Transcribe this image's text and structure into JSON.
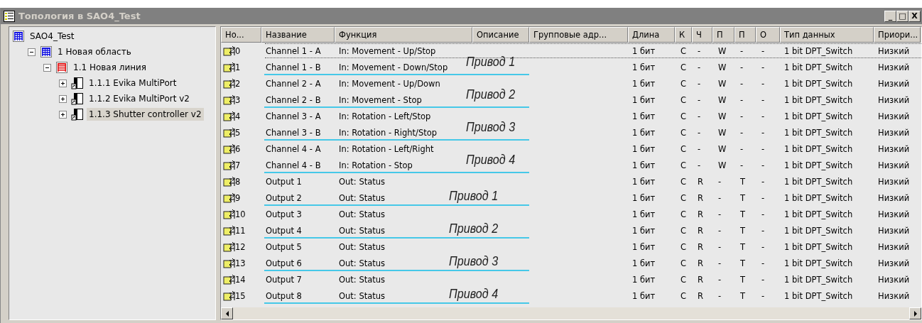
{
  "window": {
    "title": "Топология в SAO4_Test",
    "controls": [
      "_",
      "□",
      "X"
    ]
  },
  "tree": [
    {
      "label": "SAO4_Test",
      "kind": "project",
      "selected": false,
      "children": [
        {
          "label": "1 Новая область",
          "kind": "area",
          "expanded": true,
          "selected": false,
          "children": [
            {
              "label": "1.1 Новая линия",
              "kind": "line",
              "expanded": true,
              "selected": false,
              "children": [
                {
                  "label": "1.1.1 Evika MultiPort",
                  "kind": "device",
                  "expanded": false,
                  "selected": false
                },
                {
                  "label": "1.1.2 Evika MultiPort v2",
                  "kind": "device",
                  "expanded": false,
                  "selected": false
                },
                {
                  "label": "1.1.3 Shutter controller v2",
                  "kind": "device",
                  "expanded": false,
                  "selected": true
                }
              ]
            }
          ]
        }
      ]
    }
  ],
  "table": {
    "columns": [
      "Но...",
      "Название",
      "Функция",
      "Описание",
      "Групповые адр...",
      "Длина",
      "К",
      "Ч",
      "П",
      "П",
      "О",
      "Тип данных",
      "Приори..."
    ],
    "row_groups": [
      {
        "annotation": "Привод 1",
        "rows": [
          {
            "number": "0",
            "name": "Channel 1 - A",
            "function": "In: Movement - Up/Stop",
            "length": "1 бит",
            "flag_k": "C",
            "flag_ch": "-",
            "flag_p1": "W",
            "flag_p2": "-",
            "flag_o": "-",
            "data_type": "1 bit DPT_Switch",
            "priority": "Низкий",
            "focused": true
          },
          {
            "number": "1",
            "name": "Channel 1 - B",
            "function": "In: Movement - Down/Stop",
            "length": "1 бит",
            "flag_k": "C",
            "flag_ch": "-",
            "flag_p1": "W",
            "flag_p2": "-",
            "flag_o": "-",
            "data_type": "1 bit DPT_Switch",
            "priority": "Низкий",
            "focused": false
          }
        ]
      },
      {
        "annotation": "Привод 2",
        "rows": [
          {
            "number": "2",
            "name": "Channel 2 - A",
            "function": "In: Movement - Up/Down",
            "length": "1 бит",
            "flag_k": "C",
            "flag_ch": "-",
            "flag_p1": "W",
            "flag_p2": "-",
            "flag_o": "-",
            "data_type": "1 bit DPT_Switch",
            "priority": "Низкий",
            "focused": false
          },
          {
            "number": "3",
            "name": "Channel 2 - B",
            "function": "In: Movement - Stop",
            "length": "1 бит",
            "flag_k": "C",
            "flag_ch": "-",
            "flag_p1": "W",
            "flag_p2": "-",
            "flag_o": "-",
            "data_type": "1 bit DPT_Switch",
            "priority": "Низкий",
            "focused": false
          }
        ]
      },
      {
        "annotation": "Привод 3",
        "rows": [
          {
            "number": "4",
            "name": "Channel 3 - A",
            "function": "In: Rotation - Left/Stop",
            "length": "1 бит",
            "flag_k": "C",
            "flag_ch": "-",
            "flag_p1": "W",
            "flag_p2": "-",
            "flag_o": "-",
            "data_type": "1 bit DPT_Switch",
            "priority": "Низкий",
            "focused": false
          },
          {
            "number": "5",
            "name": "Channel 3 - B",
            "function": "In: Rotation - Right/Stop",
            "length": "1 бит",
            "flag_k": "C",
            "flag_ch": "-",
            "flag_p1": "W",
            "flag_p2": "-",
            "flag_o": "-",
            "data_type": "1 bit DPT_Switch",
            "priority": "Низкий",
            "focused": false
          }
        ]
      },
      {
        "annotation": "Привод 4",
        "rows": [
          {
            "number": "6",
            "name": "Channel 4 - A",
            "function": "In: Rotation - Left/Right",
            "length": "1 бит",
            "flag_k": "C",
            "flag_ch": "-",
            "flag_p1": "W",
            "flag_p2": "-",
            "flag_o": "-",
            "data_type": "1 bit DPT_Switch",
            "priority": "Низкий",
            "focused": false
          },
          {
            "number": "7",
            "name": "Channel 4 - B",
            "function": "In: Rotation - Stop",
            "length": "1 бит",
            "flag_k": "C",
            "flag_ch": "-",
            "flag_p1": "W",
            "flag_p2": "-",
            "flag_o": "-",
            "data_type": "1 bit DPT_Switch",
            "priority": "Низкий",
            "focused": false
          }
        ]
      },
      {
        "annotation": "Привод 1",
        "rows": [
          {
            "number": "8",
            "name": "Output 1",
            "function": "Out: Status",
            "length": "1 бит",
            "flag_k": "C",
            "flag_ch": "R",
            "flag_p1": "-",
            "flag_p2": "T",
            "flag_o": "-",
            "data_type": "1 bit DPT_Switch",
            "priority": "Низкий",
            "focused": false
          },
          {
            "number": "9",
            "name": "Output 2",
            "function": "Out: Status",
            "length": "1 бит",
            "flag_k": "C",
            "flag_ch": "R",
            "flag_p1": "-",
            "flag_p2": "T",
            "flag_o": "-",
            "data_type": "1 bit DPT_Switch",
            "priority": "Низкий",
            "focused": false
          }
        ]
      },
      {
        "annotation": "Привод 2",
        "rows": [
          {
            "number": "10",
            "name": "Output 3",
            "function": "Out: Status",
            "length": "1 бит",
            "flag_k": "C",
            "flag_ch": "R",
            "flag_p1": "-",
            "flag_p2": "T",
            "flag_o": "-",
            "data_type": "1 bit DPT_Switch",
            "priority": "Низкий",
            "focused": false
          },
          {
            "number": "11",
            "name": "Output 4",
            "function": "Out: Status",
            "length": "1 бит",
            "flag_k": "C",
            "flag_ch": "R",
            "flag_p1": "-",
            "flag_p2": "T",
            "flag_o": "-",
            "data_type": "1 bit DPT_Switch",
            "priority": "Низкий",
            "focused": false
          }
        ]
      },
      {
        "annotation": "Привод 3",
        "rows": [
          {
            "number": "12",
            "name": "Output 5",
            "function": "Out: Status",
            "length": "1 бит",
            "flag_k": "C",
            "flag_ch": "R",
            "flag_p1": "-",
            "flag_p2": "T",
            "flag_o": "-",
            "data_type": "1 bit DPT_Switch",
            "priority": "Низкий",
            "focused": false
          },
          {
            "number": "13",
            "name": "Output 6",
            "function": "Out: Status",
            "length": "1 бит",
            "flag_k": "C",
            "flag_ch": "R",
            "flag_p1": "-",
            "flag_p2": "T",
            "flag_o": "-",
            "data_type": "1 bit DPT_Switch",
            "priority": "Низкий",
            "focused": false
          }
        ]
      },
      {
        "annotation": "Привод 4",
        "rows": [
          {
            "number": "14",
            "name": "Output 7",
            "function": "Out: Status",
            "length": "1 бит",
            "flag_k": "C",
            "flag_ch": "R",
            "flag_p1": "-",
            "flag_p2": "T",
            "flag_o": "-",
            "data_type": "1 bit DPT_Switch",
            "priority": "Низкий",
            "focused": false
          },
          {
            "number": "15",
            "name": "Output 8",
            "function": "Out: Status",
            "length": "1 бит",
            "flag_k": "C",
            "flag_ch": "R",
            "flag_p1": "-",
            "flag_p2": "T",
            "flag_o": "-",
            "data_type": "1 bit DPT_Switch",
            "priority": "Низкий",
            "focused": false
          }
        ]
      }
    ]
  }
}
